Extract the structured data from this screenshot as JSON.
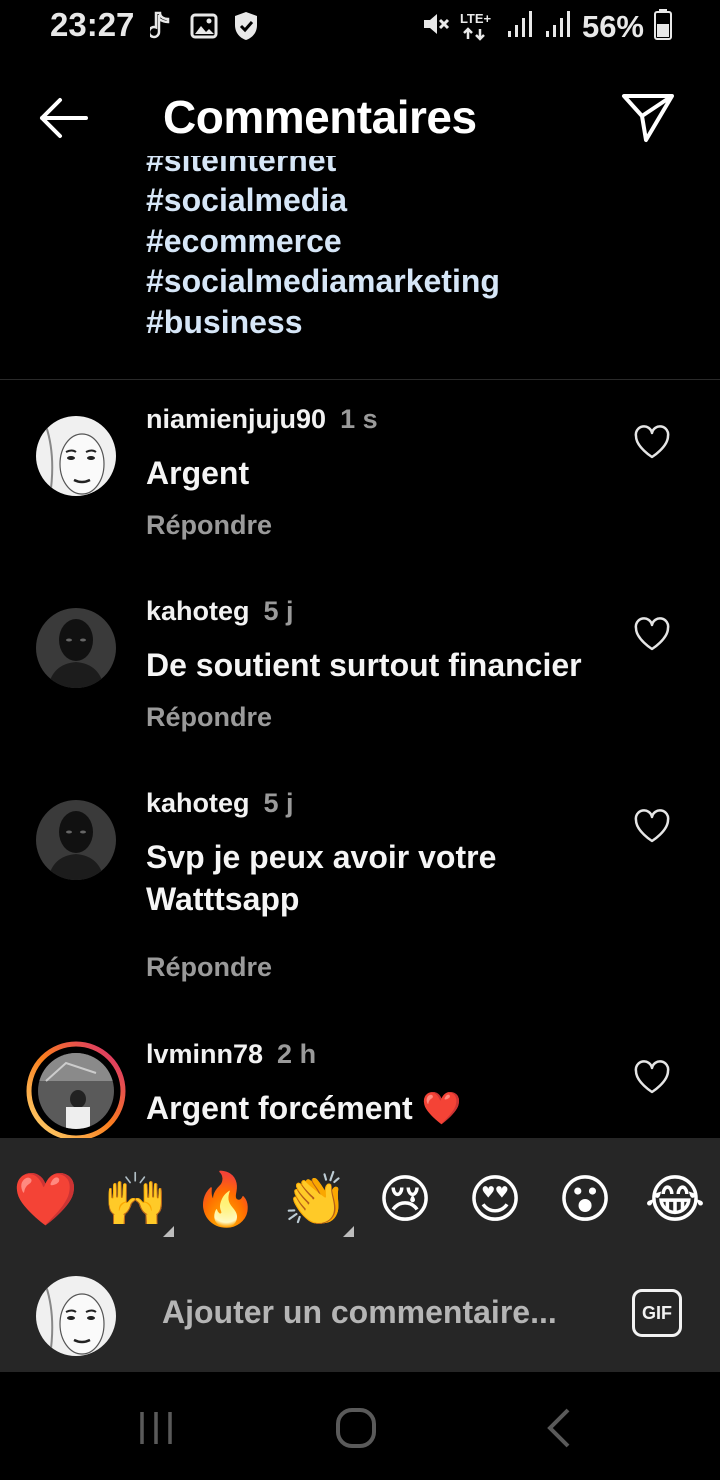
{
  "status_bar": {
    "time": "23:27",
    "lte_label": "LTE+",
    "battery": "56%",
    "icons": [
      "music-note-icon",
      "gallery-icon",
      "shield-icon",
      "mute-icon",
      "lte-icon",
      "signal-icon",
      "signal-icon",
      "battery-icon"
    ]
  },
  "header": {
    "title": "Commentaires",
    "back_icon": "arrow-left-icon",
    "send_icon": "paper-plane-icon"
  },
  "caption": {
    "clipped_tag": "#siteinternet",
    "tags": [
      "#socialmedia",
      "#ecommerce",
      "#socialmediamarketing",
      "#business"
    ]
  },
  "comments": [
    {
      "username": "niamienjuju90",
      "time": "1 s",
      "text": "Argent",
      "reply_label": "Répondre"
    },
    {
      "username": "kahoteg",
      "time": "5 j",
      "text": "De soutient surtout financier",
      "reply_label": "Répondre"
    },
    {
      "username": "kahoteg",
      "time": "5 j",
      "text": "Svp je peux avoir votre Watttsapp",
      "reply_label": "Répondre"
    },
    {
      "username": "lvminn78",
      "time": "2 h",
      "text": "Argent forcément ❤️",
      "reply_label": ""
    }
  ],
  "reactions": [
    "❤️",
    "🙌",
    "🔥",
    "👏",
    "😢",
    "😍",
    "😮",
    "😂"
  ],
  "composer": {
    "placeholder": "Ajouter un commentaire...",
    "gif_label": "GIF"
  },
  "navbar": {
    "icons": [
      "recent-apps-icon",
      "home-icon",
      "back-icon"
    ]
  },
  "colors": {
    "background": "#000000",
    "panel": "#262626",
    "hashtag": "#d6e6f7",
    "muted": "#9a9a9a",
    "story_ring_start": "#feda75",
    "story_ring_end": "#d62976"
  }
}
